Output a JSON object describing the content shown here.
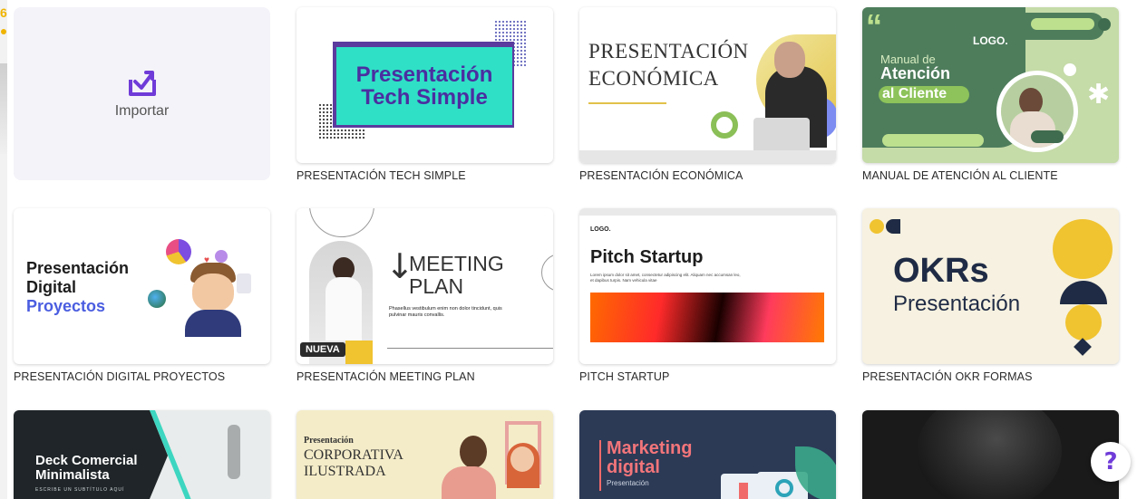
{
  "import": {
    "label": "Importar"
  },
  "templates": [
    {
      "caption": "PRESENTACIÓN TECH SIMPLE",
      "title_line1": "Presentación",
      "title_line2": "Tech Simple"
    },
    {
      "caption": "PRESENTACIÓN ECONÓMICA",
      "title_line1": "PRESENTACIÓN",
      "title_line2": "ECONÓMICA"
    },
    {
      "caption": "MANUAL DE ATENCIÓN AL CLIENTE",
      "logo": "LOGO.",
      "title_line1": "Manual de",
      "title_line2": "Atención",
      "title_line3": "al Cliente"
    },
    {
      "caption": "PRESENTACIÓN DIGITAL PROYECTOS",
      "title_line1": "Presentación",
      "title_line2": "Digital",
      "title_line3": "Proyectos"
    },
    {
      "caption": "PRESENTACIÓN MEETING PLAN",
      "title_line1": "MEETING",
      "title_line2": "PLAN",
      "arrow": "↓",
      "body": "Phasellus vestibulum enim non dolor tincidunt, quis pulvinar mauris convallis.",
      "badge": "NUEVA"
    },
    {
      "caption": "PITCH STARTUP",
      "logo": "LOGO.",
      "title": "Pitch Startup",
      "body": "Lorem ipsum dolor sit amet, consectetur adipiscing elit. Aliquam nec accumsan leo, et dapibus turpis. Nam vehicula vitae"
    },
    {
      "caption": "PRESENTACIÓN OKR FORMAS",
      "title_line1": "OKRs",
      "title_line2": "Presentación"
    },
    {
      "title_line1": "Deck Comercial",
      "title_line2": "Minimalista",
      "subtitle": "ESCRIBE UN SUBTÍTULO AQUÍ"
    },
    {
      "title_line1": "Presentación",
      "title_line2": "CORPORATIVA",
      "title_line3": "ILUSTRADA"
    },
    {
      "title_line1": "Marketing",
      "title_line2": "digital",
      "subtitle": "Presentación"
    },
    {}
  ],
  "help": {
    "glyph": "?"
  },
  "icons": {
    "import": "import-tray-icon",
    "help": "help-icon"
  },
  "colors": {
    "accent": "#6f3bd8",
    "tech_teal": "#2fe0c6",
    "okr_yellow": "#f0c330",
    "okr_navy": "#1f2b45",
    "manual_green": "#4e7d5c",
    "deck_dark": "#1f2528",
    "marketing_navy": "#2c3a56"
  }
}
